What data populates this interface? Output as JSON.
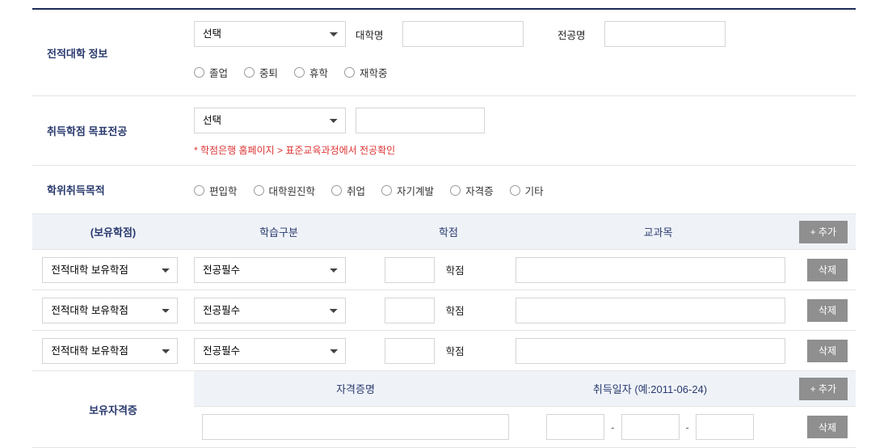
{
  "rows": {
    "prevUniv": {
      "label": "전적대학 정보",
      "select_placeholder": "선택",
      "univ_label": "대학명",
      "major_label": "전공명",
      "status_options": [
        "졸업",
        "중퇴",
        "휴학",
        "재학중"
      ]
    },
    "targetMajor": {
      "label": "취득학점 목표전공",
      "select_placeholder": "선택",
      "hint": "* 학점은행 홈페이지 > 표준교육과정에서 전공확인"
    },
    "purpose": {
      "label": "학위취득목적",
      "options": [
        "편입학",
        "대학원진학",
        "취업",
        "자기계발",
        "자격증",
        "기타"
      ]
    }
  },
  "creditHeader": {
    "title": "(보유학점)",
    "col_type": "학습구분",
    "col_credit": "학점",
    "col_subject": "교과목",
    "btn_add": "+ 추가"
  },
  "creditRows": [
    {
      "sourceSelect": "전적대학 보유학점",
      "typeSelect": "전공필수",
      "creditValue": "",
      "creditUnit": "학점",
      "subject": "",
      "btn_del": "삭제"
    },
    {
      "sourceSelect": "전적대학 보유학점",
      "typeSelect": "전공필수",
      "creditValue": "",
      "creditUnit": "학점",
      "subject": "",
      "btn_del": "삭제"
    },
    {
      "sourceSelect": "전적대학 보유학점",
      "typeSelect": "전공필수",
      "creditValue": "",
      "creditUnit": "학점",
      "subject": "",
      "btn_del": "삭제"
    }
  ],
  "cert": {
    "section_label": "보유자격증",
    "col_name": "자격증명",
    "col_date": "취득일자 (예:2011-06-24)",
    "btn_add": "+ 추가",
    "btn_del": "삭제"
  }
}
